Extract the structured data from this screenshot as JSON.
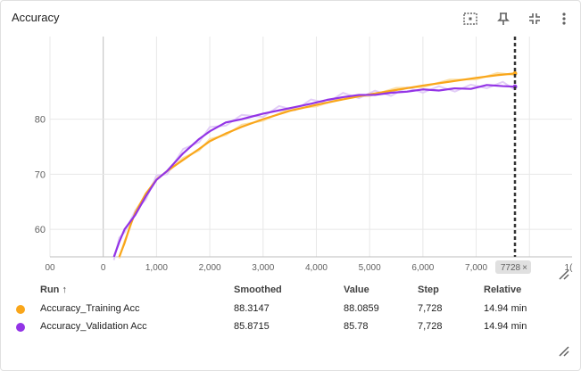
{
  "card": {
    "title": "Accuracy",
    "icons": [
      "fit-domain-icon",
      "pin-icon",
      "collapse-icon",
      "more-vert-icon"
    ]
  },
  "colors": {
    "training": "#f9a61a",
    "validation": "#9334e6",
    "training_raw": "#fbe0a8",
    "validation_raw": "#e2cdf7",
    "grid": "#e8e8e8",
    "cursor": "#333333"
  },
  "cursor_label": "7728",
  "chart_data": {
    "type": "line",
    "title": "Accuracy",
    "xlabel": "",
    "ylabel": "",
    "xlim": [
      -1000,
      8800
    ],
    "ylim": [
      55,
      95
    ],
    "x_ticks": [
      -1000,
      0,
      1000,
      2000,
      3000,
      4000,
      5000,
      6000,
      7000,
      8000,
      9000
    ],
    "x_tick_labels": [
      "00",
      "0",
      "1,000",
      "2,000",
      "3,000",
      "4,000",
      "5,000",
      "6,000",
      "7,000",
      "",
      "1("
    ],
    "y_ticks": [
      55,
      60,
      70,
      80
    ],
    "y_tick_labels": [
      "",
      "60",
      "70",
      "80"
    ],
    "grid": true,
    "cursor_x": 7728,
    "series": [
      {
        "name": "Accuracy_Training Acc",
        "x": [
          300,
          400,
          500,
          600,
          800,
          1000,
          1200,
          1500,
          1800,
          2000,
          2300,
          2600,
          3000,
          3500,
          4000,
          4500,
          5000,
          5500,
          6000,
          6500,
          7000,
          7400,
          7728
        ],
        "y": [
          55,
          57.5,
          60.5,
          63,
          66.5,
          69,
          70.6,
          72.6,
          74.6,
          76,
          77.4,
          78.6,
          80,
          81.5,
          82.6,
          83.6,
          84.5,
          85.3,
          86.1,
          86.8,
          87.5,
          88,
          88.3
        ]
      },
      {
        "name": "Accuracy_Validation Acc",
        "x": [
          200,
          300,
          400,
          600,
          800,
          1000,
          1200,
          1500,
          1800,
          2000,
          2300,
          2600,
          3000,
          3300,
          3600,
          3900,
          4200,
          4500,
          4800,
          5100,
          5400,
          5700,
          6000,
          6300,
          6600,
          6900,
          7200,
          7500,
          7728
        ],
        "y": [
          55,
          57.7,
          60,
          62.6,
          66,
          69,
          70.6,
          73.8,
          76.4,
          77.8,
          79.4,
          80,
          81,
          81.6,
          82.2,
          82.8,
          83.5,
          84,
          84.4,
          84.4,
          84.8,
          85,
          85.4,
          85.2,
          85.6,
          85.5,
          86.2,
          86,
          85.9
        ]
      }
    ]
  },
  "table": {
    "headers": {
      "run": "Run ↑",
      "smoothed": "Smoothed",
      "value": "Value",
      "step": "Step",
      "relative": "Relative"
    },
    "rows": [
      {
        "run": "Accuracy_Training Acc",
        "smoothed": "88.3147",
        "value": "88.0859",
        "step": "7,728",
        "relative": "14.94 min",
        "color": "#f9a61a"
      },
      {
        "run": "Accuracy_Validation Acc",
        "smoothed": "85.8715",
        "value": "85.78",
        "step": "7,728",
        "relative": "14.94 min",
        "color": "#9334e6"
      }
    ]
  }
}
